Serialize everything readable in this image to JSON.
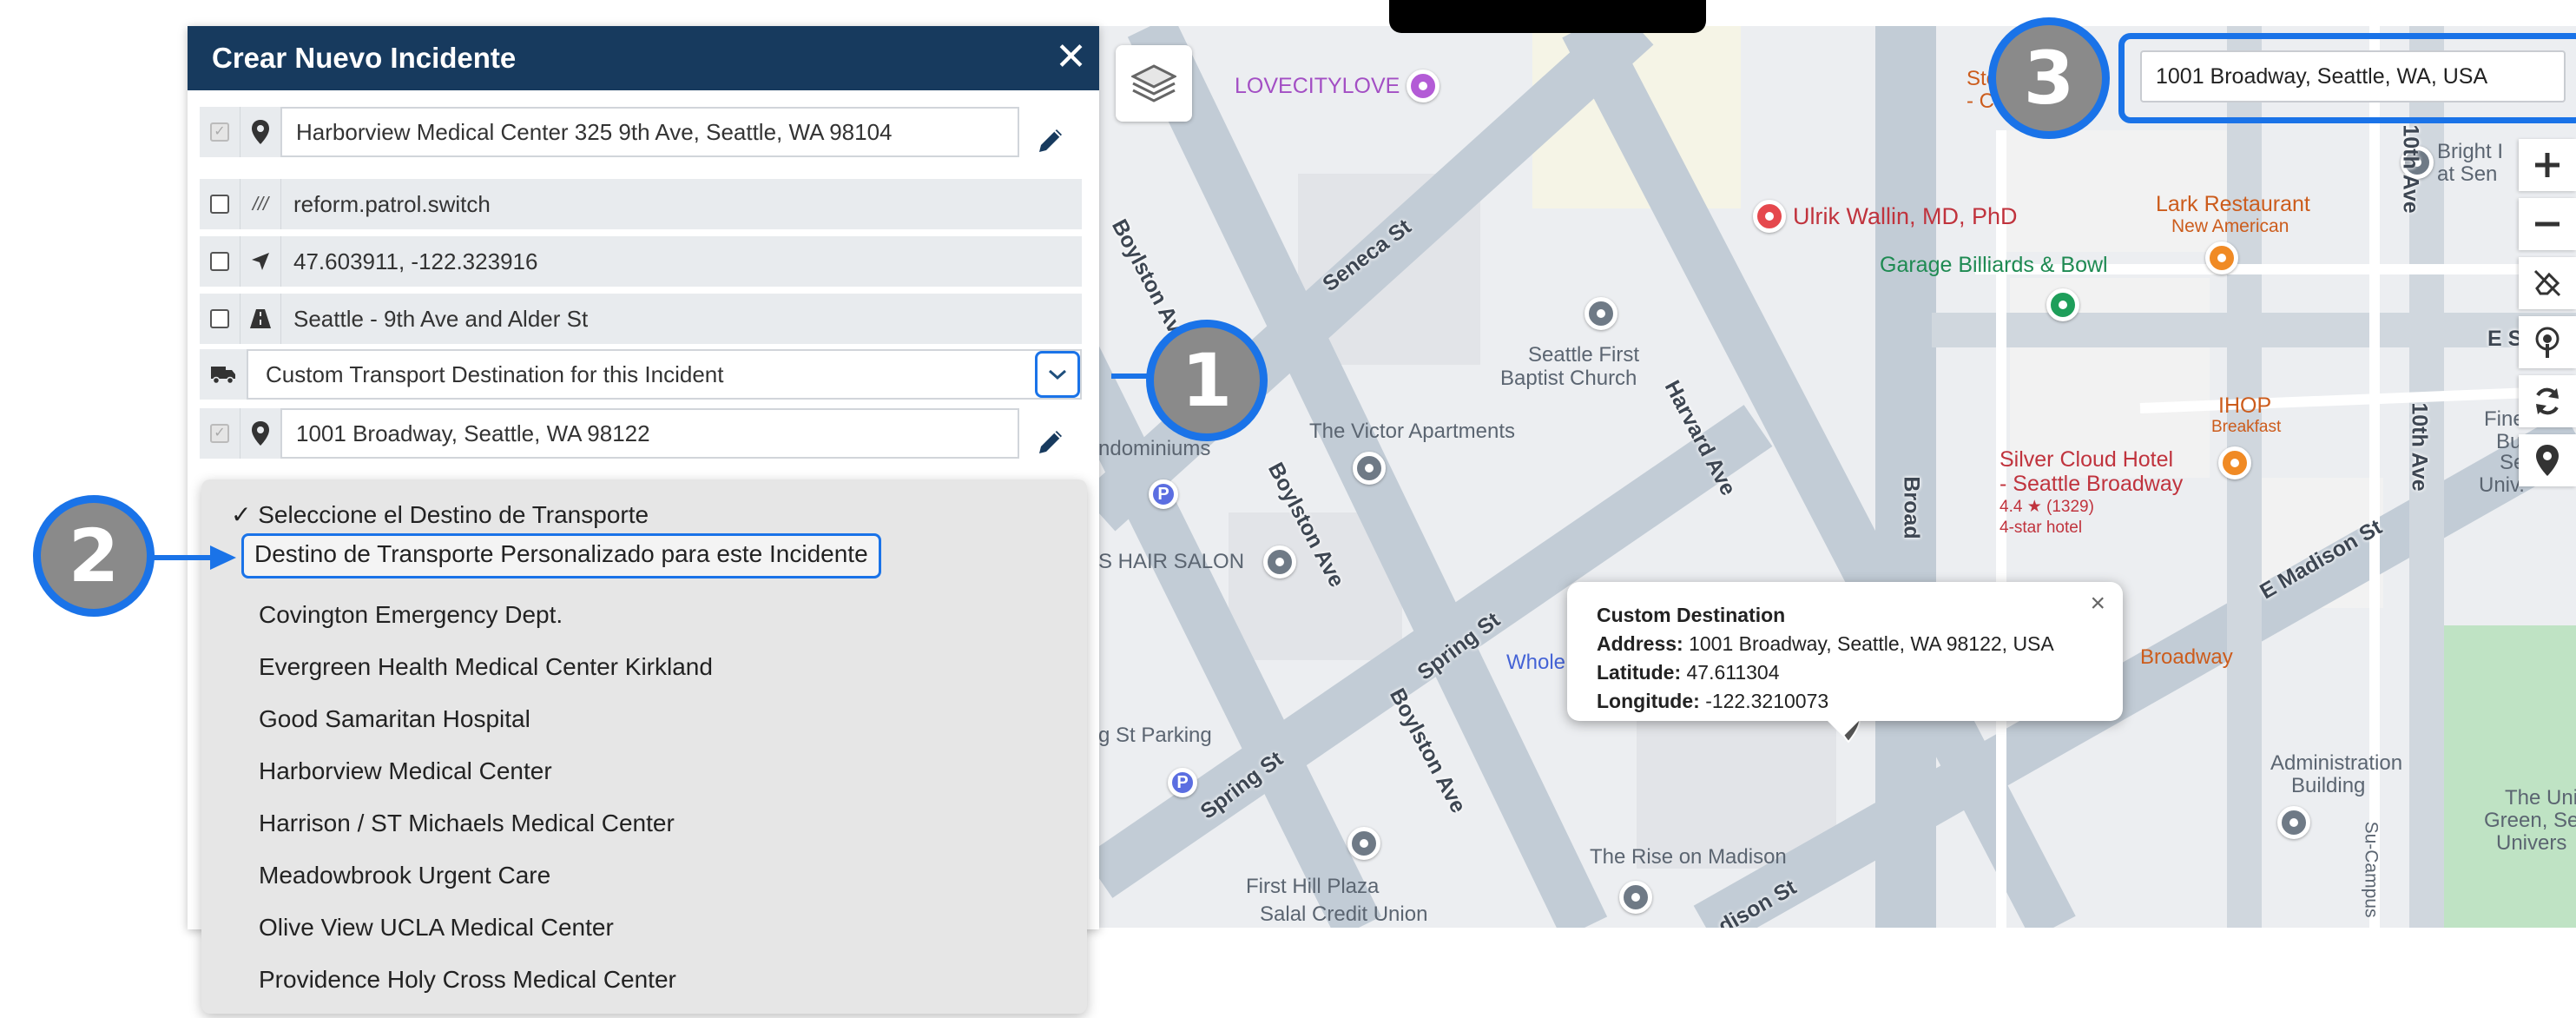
{
  "panel": {
    "title": "Crear Nuevo Incidente",
    "close_glyph": "✕",
    "rows": {
      "pickup_address": "Harborview Medical Center 325 9th Ave, Seattle, WA 98104",
      "what3words": "reform.patrol.switch",
      "coordinates": "47.603911, -122.323916",
      "cross_streets": "Seattle -  9th Ave and Alder St",
      "transport_select": "Custom Transport Destination for this Incident",
      "destination_address": "1001 Broadway, Seattle, WA 98122"
    },
    "w3w_glyph": "///"
  },
  "dropdown": {
    "header": "Seleccione el Destino de Transporte",
    "selected": "Destino de Transporte Personalizado para este Incidente",
    "options": [
      "Covington Emergency Dept.",
      "Evergreen Health Medical Center Kirkland",
      "Good Samaritan Hospital",
      "Harborview Medical Center",
      "Harrison / ST Michaels Medical Center",
      "Meadowbrook Urgent Care",
      "Olive View UCLA Medical Center",
      "Providence Holy Cross Medical Center"
    ]
  },
  "map": {
    "search_value": "1001 Broadway, Seattle, WA, USA",
    "popup": {
      "title": "Custom Destination",
      "address_label": "Address:",
      "address": "1001 Broadway, Seattle, WA 98122, USA",
      "latitude_label": "Latitude:",
      "latitude": "47.611304",
      "longitude_label": "Longitude:",
      "longitude": "-122.3210073",
      "close_glyph": "×"
    },
    "labels": {
      "lovecitylove": "LOVECITYLOVE",
      "ulrik": "Ulrik Wallin, MD, PhD",
      "garage": "Garage Billiards & Bowl",
      "lark": "Lark Restaurant",
      "lark_sub": "New American",
      "bright": "Bright I",
      "bright2": "at Sen",
      "seattle_first": "Seattle First",
      "baptist": "Baptist Church",
      "victor": "The Victor Apartments",
      "condominiums": "ndominiums",
      "hair_salon": "S HAIR SALON",
      "silver_cloud": "Silver Cloud Hotel",
      "silver_cloud2": "- Seattle Broadway",
      "silver_rating": "4.4 ★ (1329)",
      "silver_type": "4-star hotel",
      "ihop": "IHOP",
      "ihop_sub": "Breakfast",
      "whole": "Whole",
      "broadway_place": "Broadway",
      "st_parking": "g St Parking",
      "admin": "Administration",
      "admin2": "Building",
      "rise": "The Rise on Madison",
      "first_hill": "First Hill Plaza",
      "salal": "Salal Credit Union",
      "st_c": "Sto",
      "st_c2": "- C",
      "fine_arts": "Fine Arts",
      "fine_arts2": "Bu",
      "fine_arts3": "Se",
      "fine_arts4": "Univ.",
      "uni": "The Uni",
      "uni2": "Green, Se",
      "uni3": "Univers"
    },
    "streets": {
      "seneca": "Seneca St",
      "boylston1": "Boylston Ave",
      "boylston2": "Boylston Ave",
      "boylston3": "Boylston Ave",
      "harvard": "Harvard Ave",
      "spring1": "Spring St",
      "spring2": "Spring St",
      "broadway": "Broad",
      "tenth1": "10th Ave",
      "tenth2": "10th Ave",
      "e_seneca": "E Seneca St",
      "e_madison": "E Madison St",
      "madison2": "dison St",
      "su_campus": "Su-Campus"
    }
  },
  "callouts": {
    "one": "1",
    "two": "2",
    "three": "3"
  },
  "colors": {
    "header": "#173a5e",
    "accent": "#1a73e8",
    "badge": "#8a8a8a"
  }
}
